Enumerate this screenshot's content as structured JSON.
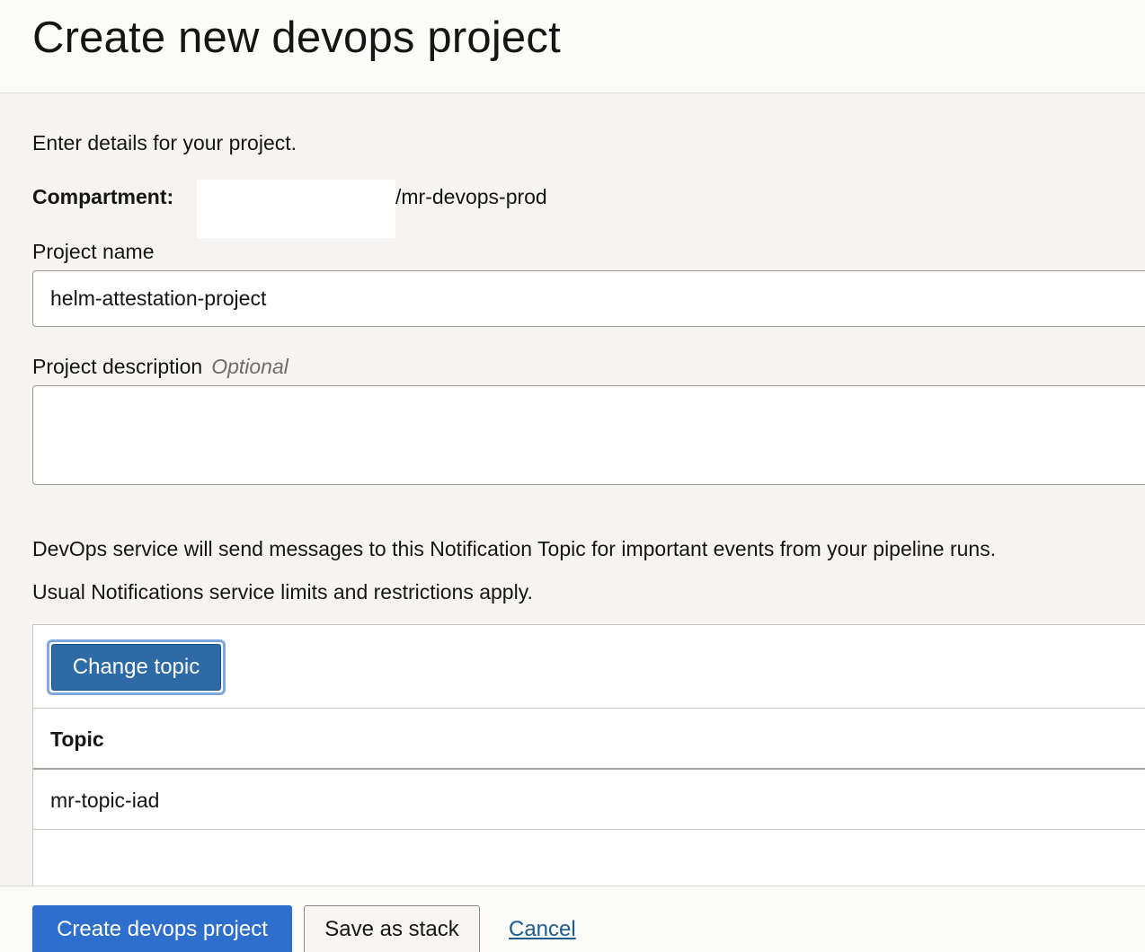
{
  "header": {
    "title": "Create new devops project"
  },
  "form": {
    "intro": "Enter details for your project.",
    "compartment_label": "Compartment:",
    "compartment_value": "/mr-devops-prod",
    "project_name_label": "Project name",
    "project_name_value": "helm-attestation-project",
    "description_label": "Project description",
    "description_optional": "Optional",
    "description_value": ""
  },
  "notifications": {
    "line1": "DevOps service will send messages to this Notification Topic for important events from your pipeline runs.",
    "line2": "Usual Notifications service limits and restrictions apply.",
    "change_topic_label": "Change topic",
    "table": {
      "columns": [
        "Topic"
      ],
      "rows": [
        [
          "mr-topic-iad"
        ]
      ]
    }
  },
  "footer": {
    "create_label": "Create devops project",
    "save_stack_label": "Save as stack",
    "cancel_label": "Cancel"
  },
  "colors": {
    "primary_button": "#2e6fce",
    "change_topic_button": "#2e6aa6",
    "link": "#1e5b8e"
  }
}
